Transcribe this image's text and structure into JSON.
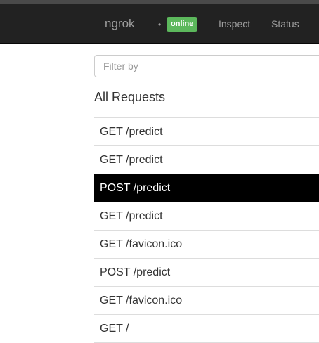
{
  "navbar": {
    "brand": "ngrok",
    "status_badge": "online",
    "links": [
      "Inspect",
      "Status"
    ]
  },
  "filter": {
    "placeholder": "Filter by",
    "value": ""
  },
  "requests": {
    "title": "All Requests",
    "selected_index": 2,
    "items": [
      "GET /predict",
      "GET /predict",
      "POST /predict",
      "GET /predict",
      "GET /favicon.ico",
      "POST /predict",
      "GET /favicon.ico",
      "GET /"
    ]
  },
  "colors": {
    "navbar_bg": "#222222",
    "badge_bg": "#5cb85c",
    "selected_row_bg": "#000000"
  }
}
